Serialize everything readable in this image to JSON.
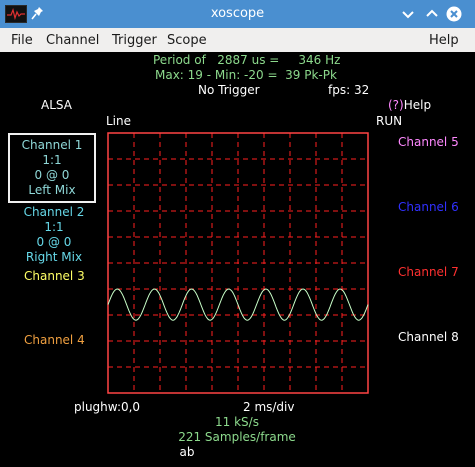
{
  "window": {
    "title": "xoscope",
    "titlebar_color": "#4a8fd0"
  },
  "menu": {
    "items": [
      "File",
      "Channel",
      "Trigger",
      "Scope"
    ],
    "help": "Help"
  },
  "stats": {
    "period_line": "Period of   2887 us =     346 Hz",
    "maxmin_line": "Max: 19 - Min: -20 =  39 Pk-Pk",
    "trigger": "No Trigger",
    "fps": "fps: 32"
  },
  "source": "ALSA",
  "line_label": "Line",
  "help_hint": {
    "key": "(?)",
    "label": "Help"
  },
  "run_state": "RUN",
  "channels": {
    "ch1": {
      "name": "Channel 1",
      "scale": "1:1",
      "pos": "0 @ 0",
      "signal": "Left Mix",
      "color": "#8fd8d8"
    },
    "ch2": {
      "name": "Channel 2",
      "scale": "1:1",
      "pos": "0 @ 0",
      "signal": "Right Mix",
      "color": "#66d8e8"
    },
    "ch3": {
      "name": "Channel 3",
      "color": "#ffff66"
    },
    "ch4": {
      "name": "Channel 4",
      "color": "#f0a040"
    },
    "ch5": {
      "name": "Channel 5",
      "color": "#ff88ff"
    },
    "ch6": {
      "name": "Channel 6",
      "color": "#3030ff"
    },
    "ch7": {
      "name": "Channel 7",
      "color": "#ff3030"
    },
    "ch8": {
      "name": "Channel 8",
      "color": "#ffffff"
    }
  },
  "footer": {
    "device": "plughw:0,0",
    "timebase": "2 ms/div",
    "rate": "11 kS/s",
    "samples": "221 Samples/frame",
    "channels": "ab"
  },
  "graticule": {
    "border_color": "#ff4444",
    "grid_color": "#ff2020",
    "h_divisions": 10,
    "v_divisions": 10
  },
  "trace": {
    "color": "#c8ffc8",
    "cycles_visible": 7,
    "amplitude_divisions": 0.6,
    "offset_divisions": -1.6
  }
}
